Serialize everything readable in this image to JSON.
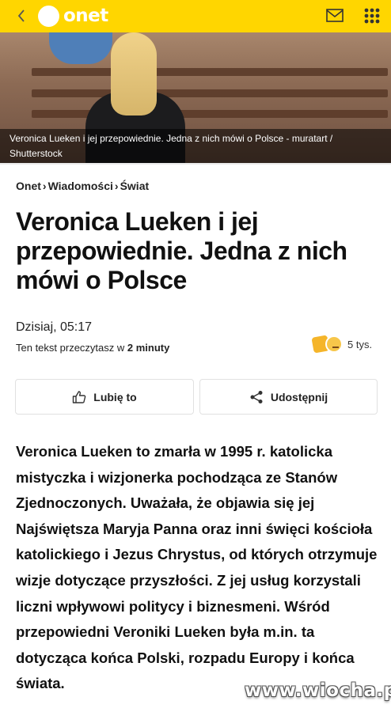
{
  "header": {
    "logo_text": "onet",
    "accent": "#ffd600",
    "icons": [
      "back-chevron-icon",
      "mail-icon",
      "apps-grid-icon"
    ]
  },
  "hero": {
    "caption": "Veronica Lueken i jej przepowiednie. Jedna z nich mówi o Polsce - muratart / Shutterstock"
  },
  "breadcrumb": {
    "items": [
      "Onet",
      "Wiadomości",
      "Świat"
    ],
    "separator": "›"
  },
  "article": {
    "title": "Veronica Lueken i jej przepowiednie. Jedna z nich mówi o Polsce",
    "date": "Dzisiaj, 05:17",
    "read_prefix": "Ten tekst przeczytasz w ",
    "read_time": "2 minuty",
    "reactions_count": "5 tys.",
    "lead": "Veronica Lueken to zmarła w 1995 r. katolicka mistyczka i wizjonerka pochodząca ze Stanów Zjednoczonych. Uważała, że objawia się jej Najświętsza Maryja Panna oraz inni święci kościoła katolickiego i Jezus Chrystus, od których otrzymuje wizje dotyczące przyszłości. Z jej usług korzystali liczni wpływowi politycy i biznesmeni. Wśród przepowiedni Veroniki Lueken była m.in. ta dotycząca końca Polski, rozpadu Europy i końca świata."
  },
  "actions": {
    "like_label": "Lubię to",
    "share_label": "Udostępnij"
  },
  "watermark": "www.wiocha.pl"
}
